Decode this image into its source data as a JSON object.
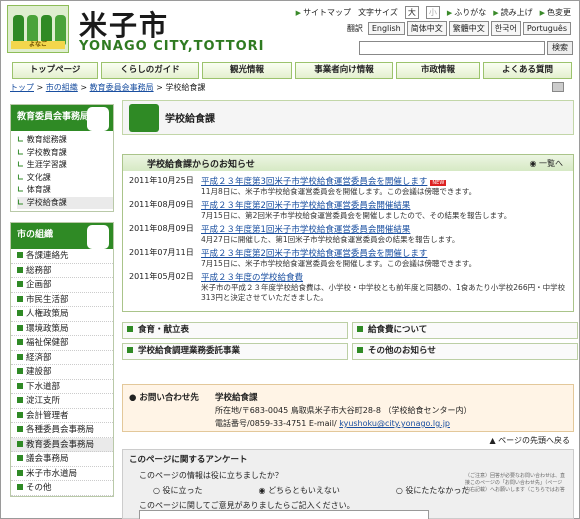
{
  "header": {
    "logo_title": "米子市",
    "logo_sub": "YONAGO CITY,TOTTORI",
    "logo_badge": "よなご"
  },
  "util": {
    "sitemap": "サイトマップ",
    "fontsize": "文字サイズ",
    "large": "大",
    "small": "小",
    "furigana": "ふりがな",
    "yomiage": "読み上げ",
    "iro": "色変更"
  },
  "lang": {
    "label": "翻訳",
    "items": [
      "English",
      "简体中文",
      "繁體中文",
      "한국어",
      "Português"
    ]
  },
  "search": {
    "button": "検索"
  },
  "nav": [
    "トップページ",
    "くらしのガイド",
    "観光情報",
    "事業者向け情報",
    "市政情報",
    "よくある質問"
  ],
  "breadcrumb": [
    "トップ",
    "市の組織",
    "教育委員会事務局",
    "学校給食課"
  ],
  "side1": {
    "title": "教育委員会事務局",
    "items": [
      "教育総務課",
      "学校教育課",
      "生涯学習課",
      "文化課",
      "体育課",
      "学校給食課"
    ]
  },
  "side2": {
    "title": "市の組織",
    "items": [
      "各課連絡先",
      "総務部",
      "企画部",
      "市民生活部",
      "人権政策局",
      "環境政策局",
      "福祉保健部",
      "経済部",
      "建設部",
      "下水道部",
      "淀江支所",
      "会計管理者",
      "各種委員会事務局",
      "教育委員会事務局",
      "議会事務局",
      "米子市水道局",
      "その他"
    ]
  },
  "page_title": "学校給食課",
  "notice": {
    "title": "学校給食課からのお知らせ",
    "more": "一覧へ",
    "new_badge": "NEW",
    "items": [
      {
        "date": "2011年10月25日",
        "title": "平成２３年度第3回米子市学校給食運営委員会を開催します",
        "summary": "11月8日に、米子市学校給食運営委員会を開催します。この会議は傍聴できます。",
        "new": true
      },
      {
        "date": "2011年08月09日",
        "title": "平成２３年度第2回米子市学校給食運営委員会開催結果",
        "summary": "7月15日に、第2回米子市学校給食運営委員会を開催しましたので、その結果を報告します。",
        "new": false
      },
      {
        "date": "2011年08月09日",
        "title": "平成２３年度第1回米子市学校給食運営委員会開催結果",
        "summary": "4月27日に開催した、第1回米子市学校給食運営委員会の結果を報告します。",
        "new": false
      },
      {
        "date": "2011年07月11日",
        "title": "平成２３年度第2回米子市学校給食運営委員会を開催します",
        "summary": "7月15日に、米子市学校給食運営委員会を開催します。この会議は傍聴できます。",
        "new": false
      },
      {
        "date": "2011年05月02日",
        "title": "平成２３年度の学校給食費",
        "summary": "米子市の平成２３年度学校給食費は、小学校・中学校とも前年度と同額の、1食あたり小学校266円・中学校313円と決定させていただきました。",
        "new": false
      }
    ]
  },
  "links": [
    "食育・献立表",
    "給食費について",
    "学校給食調理業務委託事業",
    "その他のお知らせ"
  ],
  "contact": {
    "label": "お問い合わせ先",
    "name": "学校給食課",
    "address": "所在地/〒683-0045 鳥取県米子市大谷町28-8 （学校給食センター内）",
    "tel": "電話番号/0859-33-4751 E-mail/ ",
    "email": "kyushoku@city.yonago.lg.jp"
  },
  "totop": "ページの先頭へ戻る",
  "survey": {
    "title": "このページに関するアンケート",
    "q1": "このページの情報は役に立ちましたか？",
    "opts": [
      "役に立った",
      "どちらともいえない",
      "役にたたなかった"
    ],
    "q2": "このページに関してご意見がありましたらご記入ください。",
    "note": "（ご注意）回答が必要なお問い合わせは、直接このページの「お問い合わせ先」（ページ内右記載）へお願いします（こちらではお答"
  }
}
